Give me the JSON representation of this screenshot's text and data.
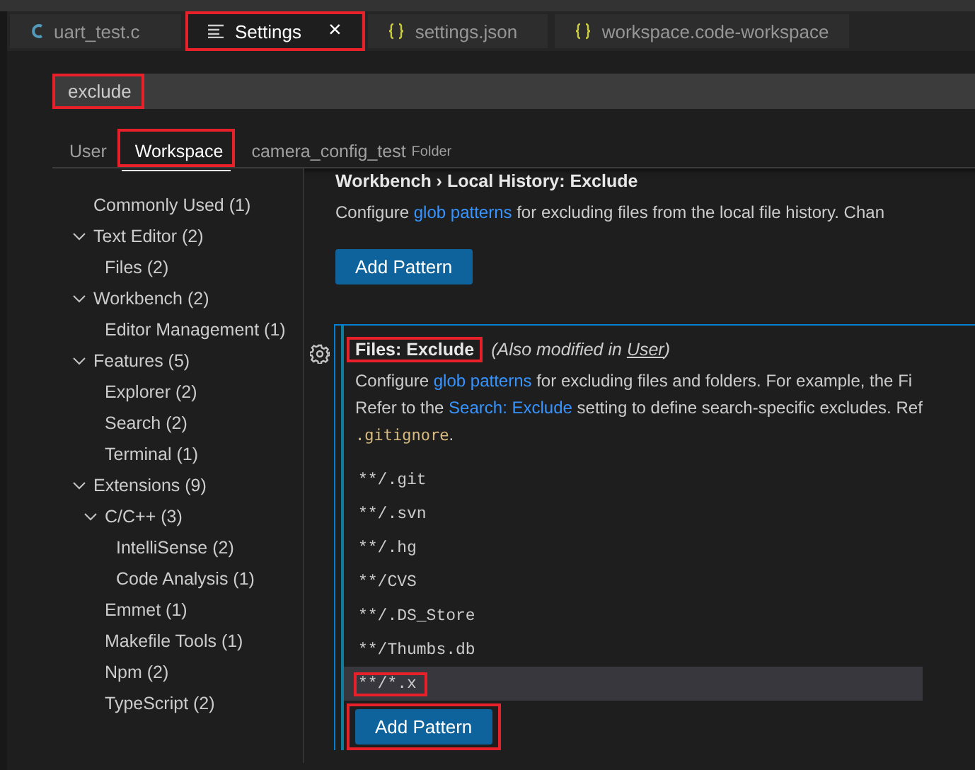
{
  "tabs": [
    {
      "label": "uart_test.c",
      "kind": "c",
      "selected": false,
      "highlighted": false
    },
    {
      "label": "Settings",
      "kind": "settings",
      "selected": true,
      "highlighted": true,
      "close": "×"
    },
    {
      "label": "settings.json",
      "kind": "json",
      "selected": false,
      "highlighted": false
    },
    {
      "label": "workspace.code-workspace",
      "kind": "json",
      "selected": false,
      "highlighted": false
    }
  ],
  "search": {
    "value": "exclude",
    "highlighted": true
  },
  "scopes": [
    {
      "label": "User",
      "selected": false,
      "highlighted": false
    },
    {
      "label": "Workspace",
      "selected": true,
      "highlighted": true
    },
    {
      "label": "camera_config_test",
      "selected": false,
      "highlighted": false,
      "badge": "Folder"
    }
  ],
  "toc": [
    {
      "label": "Commonly Used (1)"
    },
    {
      "label": "Text Editor (2)",
      "expanded": true,
      "children": [
        {
          "label": "Files (2)"
        }
      ]
    },
    {
      "label": "Workbench (2)",
      "expanded": true,
      "children": [
        {
          "label": "Editor Management (1)"
        }
      ]
    },
    {
      "label": "Features (5)",
      "expanded": true,
      "children": [
        {
          "label": "Explorer (2)"
        },
        {
          "label": "Search (2)"
        },
        {
          "label": "Terminal (1)"
        }
      ]
    },
    {
      "label": "Extensions (9)",
      "expanded": true,
      "children": [
        {
          "label": "C/C++ (3)",
          "expanded": true,
          "children": [
            {
              "label": "IntelliSense (2)"
            },
            {
              "label": "Code Analysis (1)"
            }
          ]
        },
        {
          "label": "Emmet (1)"
        },
        {
          "label": "Makefile Tools (1)"
        },
        {
          "label": "Npm (2)"
        },
        {
          "label": "TypeScript (2)"
        }
      ]
    }
  ],
  "settings": [
    {
      "title": "Workbench › Local History: Exclude",
      "focused": false,
      "modified": false,
      "highlighted": false,
      "lines": [
        [
          {
            "kind": "text",
            "text": "Configure "
          },
          {
            "kind": "link",
            "text": "glob patterns"
          },
          {
            "kind": "text",
            "text": " for excluding files from the local file history. Chan"
          }
        ]
      ],
      "button": {
        "label": "Add Pattern",
        "highlighted": false
      }
    },
    {
      "title": "Files: Exclude",
      "focused": true,
      "modified": true,
      "highlighted": true,
      "note": {
        "prefix": "(Also modified in ",
        "link": "User",
        "suffix": ")"
      },
      "lines": [
        [
          {
            "kind": "text",
            "text": "Configure "
          },
          {
            "kind": "link",
            "text": "glob patterns"
          },
          {
            "kind": "text",
            "text": " for excluding files and folders. For example, the Fi"
          }
        ],
        [
          {
            "kind": "text",
            "text": "Refer to the "
          },
          {
            "kind": "link",
            "text": "Search: Exclude"
          },
          {
            "kind": "text",
            "text": " setting to define search-specific excludes. Ref"
          }
        ],
        [
          {
            "kind": "code",
            "text": ".gitignore"
          },
          {
            "kind": "text",
            "text": "."
          }
        ]
      ],
      "patterns": [
        {
          "value": "**/.git",
          "selected": false,
          "highlighted": false
        },
        {
          "value": "**/.svn",
          "selected": false,
          "highlighted": false
        },
        {
          "value": "**/.hg",
          "selected": false,
          "highlighted": false
        },
        {
          "value": "**/CVS",
          "selected": false,
          "highlighted": false
        },
        {
          "value": "**/.DS_Store",
          "selected": false,
          "highlighted": false
        },
        {
          "value": "**/Thumbs.db",
          "selected": false,
          "highlighted": false
        },
        {
          "value": "**/*.x",
          "selected": true,
          "highlighted": true
        }
      ],
      "button": {
        "label": "Add Pattern",
        "highlighted": true
      }
    }
  ]
}
